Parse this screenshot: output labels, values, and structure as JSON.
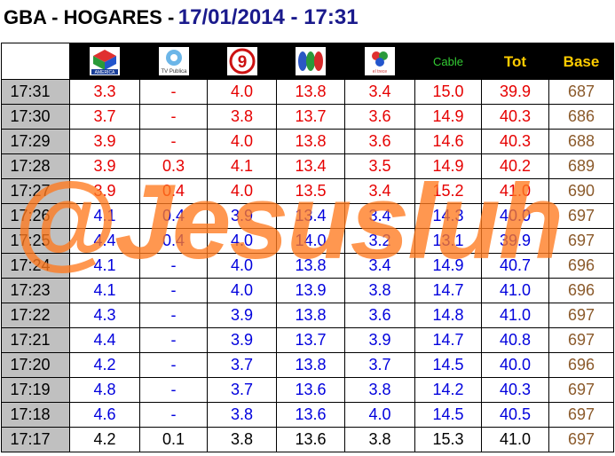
{
  "title": {
    "left": "GBA - HOGARES -",
    "right": "17/01/2014 - 17:31"
  },
  "headers": {
    "ch1": "AMERICA",
    "ch2": "TV Publica",
    "ch3": "9",
    "ch4": "",
    "ch5": "el trece",
    "cable": "Cable",
    "tot": "Tot",
    "base": "Base"
  },
  "colors": {
    "red": "#e60000",
    "blue": "#0000dd",
    "black": "#000000",
    "brown": "#8b5a2b",
    "watermark": "#ff7a1f"
  },
  "watermark": "@Jesusluh",
  "rows": [
    {
      "time": "17:31",
      "ch1": "3.3",
      "ch2": "-",
      "ch3": "4.0",
      "ch4": "13.8",
      "ch5": "3.4",
      "cable": "15.0",
      "tot": "39.9",
      "base": "687",
      "color": "red"
    },
    {
      "time": "17:30",
      "ch1": "3.7",
      "ch2": "-",
      "ch3": "3.8",
      "ch4": "13.7",
      "ch5": "3.6",
      "cable": "14.9",
      "tot": "40.3",
      "base": "686",
      "color": "red"
    },
    {
      "time": "17:29",
      "ch1": "3.9",
      "ch2": "-",
      "ch3": "4.0",
      "ch4": "13.8",
      "ch5": "3.6",
      "cable": "14.6",
      "tot": "40.3",
      "base": "688",
      "color": "red"
    },
    {
      "time": "17:28",
      "ch1": "3.9",
      "ch2": "0.3",
      "ch3": "4.1",
      "ch4": "13.4",
      "ch5": "3.5",
      "cable": "14.9",
      "tot": "40.2",
      "base": "689",
      "color": "red"
    },
    {
      "time": "17:27",
      "ch1": "3.9",
      "ch2": "0.4",
      "ch3": "4.0",
      "ch4": "13.5",
      "ch5": "3.4",
      "cable": "15.2",
      "tot": "41.0",
      "base": "690",
      "color": "red"
    },
    {
      "time": "17:26",
      "ch1": "4.1",
      "ch2": "0.4",
      "ch3": "3.9",
      "ch4": "13.4",
      "ch5": "3.4",
      "cable": "14.3",
      "tot": "40.0",
      "base": "697",
      "color": "blue"
    },
    {
      "time": "17:25",
      "ch1": "4.4",
      "ch2": "0.4",
      "ch3": "4.0",
      "ch4": "14.0",
      "ch5": "3.2",
      "cable": "13.1",
      "tot": "39.9",
      "base": "697",
      "color": "blue"
    },
    {
      "time": "17:24",
      "ch1": "4.1",
      "ch2": "-",
      "ch3": "4.0",
      "ch4": "13.8",
      "ch5": "3.4",
      "cable": "14.9",
      "tot": "40.7",
      "base": "696",
      "color": "blue"
    },
    {
      "time": "17:23",
      "ch1": "4.1",
      "ch2": "-",
      "ch3": "4.0",
      "ch4": "13.9",
      "ch5": "3.8",
      "cable": "14.7",
      "tot": "41.0",
      "base": "696",
      "color": "blue"
    },
    {
      "time": "17:22",
      "ch1": "4.3",
      "ch2": "-",
      "ch3": "3.9",
      "ch4": "13.8",
      "ch5": "3.6",
      "cable": "14.8",
      "tot": "41.0",
      "base": "697",
      "color": "blue"
    },
    {
      "time": "17:21",
      "ch1": "4.4",
      "ch2": "-",
      "ch3": "3.9",
      "ch4": "13.7",
      "ch5": "3.9",
      "cable": "14.7",
      "tot": "40.8",
      "base": "697",
      "color": "blue"
    },
    {
      "time": "17:20",
      "ch1": "4.2",
      "ch2": "-",
      "ch3": "3.7",
      "ch4": "13.8",
      "ch5": "3.7",
      "cable": "14.5",
      "tot": "40.0",
      "base": "696",
      "color": "blue"
    },
    {
      "time": "17:19",
      "ch1": "4.8",
      "ch2": "-",
      "ch3": "3.7",
      "ch4": "13.6",
      "ch5": "3.8",
      "cable": "14.2",
      "tot": "40.3",
      "base": "697",
      "color": "blue"
    },
    {
      "time": "17:18",
      "ch1": "4.6",
      "ch2": "-",
      "ch3": "3.8",
      "ch4": "13.6",
      "ch5": "4.0",
      "cable": "14.5",
      "tot": "40.5",
      "base": "697",
      "color": "blue"
    },
    {
      "time": "17:17",
      "ch1": "4.2",
      "ch2": "0.1",
      "ch3": "3.8",
      "ch4": "13.6",
      "ch5": "3.8",
      "cable": "15.3",
      "tot": "41.0",
      "base": "697",
      "color": "black"
    }
  ]
}
